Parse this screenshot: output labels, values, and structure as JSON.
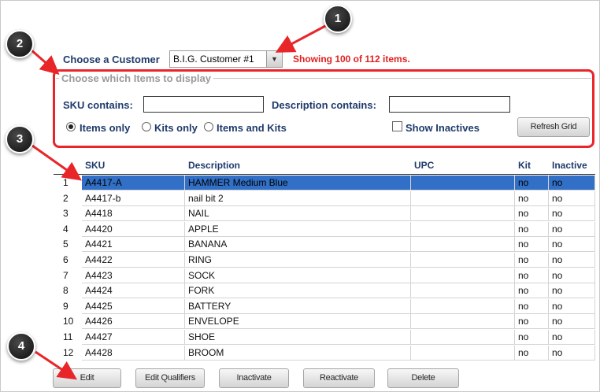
{
  "customer": {
    "label": "Choose a Customer",
    "selected": "B.I.G. Customer #1",
    "status": "Showing 100 of 112 items."
  },
  "filters": {
    "legend": "Choose which Items to display",
    "sku_label": "SKU contains:",
    "sku_value": "",
    "description_label": "Description contains:",
    "description_value": "",
    "radio_items_only": "Items only",
    "radio_kits_only": "Kits only",
    "radio_items_and_kits": "Items and Kits",
    "selected_radio": "Items only",
    "show_inactives_label": "Show Inactives",
    "show_inactives_checked": false,
    "refresh_label": "Refresh Grid"
  },
  "grid": {
    "columns": [
      "SKU",
      "Description",
      "UPC",
      "Kit",
      "Inactive"
    ],
    "selected_row": 1,
    "rows": [
      {
        "n": "1",
        "sku": "A4417-A",
        "description": "HAMMER Medium Blue",
        "upc": "",
        "kit": "no",
        "inactive": "no"
      },
      {
        "n": "2",
        "sku": "A4417-b",
        "description": "nail bit 2",
        "upc": "",
        "kit": "no",
        "inactive": "no"
      },
      {
        "n": "3",
        "sku": "A4418",
        "description": "NAIL",
        "upc": "",
        "kit": "no",
        "inactive": "no"
      },
      {
        "n": "4",
        "sku": "A4420",
        "description": "APPLE",
        "upc": "",
        "kit": "no",
        "inactive": "no"
      },
      {
        "n": "5",
        "sku": "A4421",
        "description": "BANANA",
        "upc": "",
        "kit": "no",
        "inactive": "no"
      },
      {
        "n": "6",
        "sku": "A4422",
        "description": "RING",
        "upc": "",
        "kit": "no",
        "inactive": "no"
      },
      {
        "n": "7",
        "sku": "A4423",
        "description": "SOCK",
        "upc": "",
        "kit": "no",
        "inactive": "no"
      },
      {
        "n": "8",
        "sku": "A4424",
        "description": "FORK",
        "upc": "",
        "kit": "no",
        "inactive": "no"
      },
      {
        "n": "9",
        "sku": "A4425",
        "description": "BATTERY",
        "upc": "",
        "kit": "no",
        "inactive": "no"
      },
      {
        "n": "10",
        "sku": "A4426",
        "description": "ENVELOPE",
        "upc": "",
        "kit": "no",
        "inactive": "no"
      },
      {
        "n": "11",
        "sku": "A4427",
        "description": "SHOE",
        "upc": "",
        "kit": "no",
        "inactive": "no"
      },
      {
        "n": "12",
        "sku": "A4428",
        "description": "BROOM",
        "upc": "",
        "kit": "no",
        "inactive": "no"
      }
    ]
  },
  "actions": {
    "edit": "Edit",
    "edit_qualifiers": "Edit Qualifiers",
    "inactivate": "Inactivate",
    "reactivate": "Reactivate",
    "delete": "Delete"
  },
  "annotations": {
    "badge_1": "1",
    "badge_2": "2",
    "badge_3": "3",
    "badge_4": "4",
    "callout_color": "#e8262a"
  },
  "colors": {
    "label_text": "#1f3a6b",
    "status_text": "#e02020",
    "selection": "#3170c6"
  },
  "icons": {
    "dropdown": "chevron-down-icon",
    "arrow": "red-callout-arrow"
  }
}
